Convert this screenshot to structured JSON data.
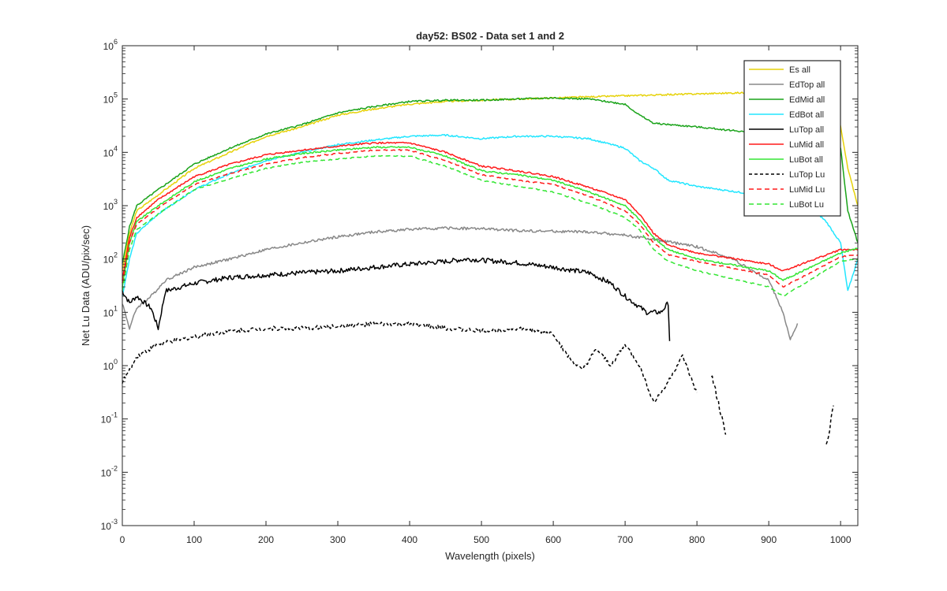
{
  "chart_data": {
    "type": "line",
    "title": "day52: BS02 - Data set 1 and 2",
    "xlabel": "Wavelength (pixels)",
    "ylabel": "Net Lu Data (ADU/pix/sec)",
    "xlim": [
      0,
      1024
    ],
    "ylim": [
      0.001,
      1000000
    ],
    "y_scale": "log",
    "x_ticks": [
      0,
      100,
      200,
      300,
      400,
      500,
      600,
      700,
      800,
      900,
      1000
    ],
    "y_ticks": [
      {
        "value": 0.001,
        "base": "10",
        "exp": "-3"
      },
      {
        "value": 0.01,
        "base": "10",
        "exp": "-2"
      },
      {
        "value": 0.1,
        "base": "10",
        "exp": "-1"
      },
      {
        "value": 1,
        "base": "10",
        "exp": "0"
      },
      {
        "value": 10,
        "base": "10",
        "exp": "1"
      },
      {
        "value": 100,
        "base": "10",
        "exp": "2"
      },
      {
        "value": 1000,
        "base": "10",
        "exp": "3"
      },
      {
        "value": 10000,
        "base": "10",
        "exp": "4"
      },
      {
        "value": 100000,
        "base": "10",
        "exp": "5"
      },
      {
        "value": 1000000,
        "base": "10",
        "exp": "6"
      }
    ],
    "grid": false,
    "legend_position": "top-right",
    "series": [
      {
        "name": "Es  all",
        "color": "#e6d20a",
        "dash": "solid",
        "x": [
          0,
          10,
          20,
          50,
          100,
          150,
          200,
          250,
          300,
          350,
          400,
          450,
          500,
          550,
          600,
          650,
          700,
          750,
          800,
          900,
          990,
          1000,
          1010,
          1024
        ],
        "y": [
          60,
          300,
          800,
          1600,
          5000,
          10000,
          20000,
          30000,
          50000,
          65000,
          80000,
          90000,
          95000,
          100000,
          105000,
          110000,
          115000,
          120000,
          125000,
          135000,
          135000,
          30000,
          5000,
          1000
        ]
      },
      {
        "name": "EdTop  all",
        "color": "#888888",
        "dash": "solid",
        "x": [
          0,
          10,
          20,
          40,
          60,
          100,
          150,
          200,
          250,
          300,
          350,
          400,
          450,
          500,
          550,
          600,
          650,
          700,
          750,
          800,
          850,
          900,
          920,
          930,
          940
        ],
        "y": [
          15,
          5,
          12,
          20,
          40,
          70,
          100,
          150,
          200,
          260,
          320,
          360,
          380,
          370,
          340,
          330,
          320,
          280,
          220,
          170,
          100,
          40,
          10,
          3,
          6
        ]
      },
      {
        "name": "EdMid  all",
        "color": "#1aa31a",
        "dash": "solid",
        "x": [
          0,
          10,
          20,
          50,
          100,
          150,
          200,
          250,
          300,
          350,
          400,
          450,
          500,
          550,
          600,
          650,
          700,
          720,
          740,
          800,
          900,
          1000,
          1010,
          1024
        ],
        "y": [
          80,
          400,
          1000,
          2000,
          6000,
          12000,
          22000,
          33000,
          55000,
          72000,
          90000,
          95000,
          95000,
          100000,
          105000,
          100000,
          80000,
          50000,
          35000,
          30000,
          22000,
          12000,
          800,
          200
        ]
      },
      {
        "name": "EdBot  all",
        "color": "#22e6ff",
        "dash": "solid",
        "x": [
          0,
          10,
          20,
          50,
          100,
          150,
          200,
          250,
          300,
          350,
          400,
          450,
          500,
          550,
          600,
          650,
          700,
          720,
          740,
          760,
          800,
          900,
          960,
          980,
          1000,
          1010,
          1024
        ],
        "y": [
          20,
          100,
          300,
          700,
          2000,
          4000,
          7000,
          10000,
          14000,
          17000,
          20000,
          21000,
          18000,
          20000,
          20000,
          18000,
          12000,
          7000,
          5000,
          3000,
          2300,
          1500,
          900,
          500,
          200,
          25,
          100
        ]
      },
      {
        "name": "LuTop  all",
        "color": "#000000",
        "dash": "solid",
        "x": [
          0,
          10,
          20,
          40,
          50,
          60,
          100,
          150,
          200,
          250,
          300,
          350,
          400,
          450,
          480,
          500,
          550,
          600,
          650,
          680,
          700,
          730,
          750,
          760,
          762
        ],
        "y": [
          25,
          15,
          20,
          12,
          5,
          25,
          35,
          45,
          50,
          55,
          60,
          70,
          80,
          90,
          100,
          95,
          85,
          70,
          55,
          35,
          20,
          10,
          10,
          15,
          3
        ]
      },
      {
        "name": "LuMid  all",
        "color": "#ff1a1a",
        "dash": "solid",
        "x": [
          0,
          10,
          20,
          50,
          100,
          150,
          200,
          250,
          300,
          350,
          400,
          450,
          500,
          550,
          600,
          650,
          700,
          720,
          740,
          760,
          800,
          900,
          920,
          1000,
          1024
        ],
        "y": [
          40,
          250,
          600,
          1300,
          3500,
          6000,
          9000,
          11000,
          13000,
          15000,
          15000,
          10000,
          5500,
          4500,
          3500,
          2200,
          1300,
          700,
          300,
          180,
          130,
          80,
          60,
          150,
          150
        ]
      },
      {
        "name": "LuBot  all",
        "color": "#33e633",
        "dash": "solid",
        "x": [
          0,
          10,
          20,
          50,
          100,
          150,
          200,
          250,
          300,
          350,
          400,
          450,
          500,
          550,
          600,
          650,
          700,
          720,
          740,
          760,
          800,
          900,
          920,
          1000,
          1024
        ],
        "y": [
          30,
          200,
          500,
          1000,
          2800,
          5000,
          7500,
          9500,
          11000,
          12500,
          12500,
          8500,
          4500,
          3800,
          3000,
          1800,
          1000,
          550,
          250,
          150,
          100,
          60,
          40,
          130,
          160
        ]
      },
      {
        "name": "LuTop  Lu",
        "color": "#000000",
        "dash": "4,3",
        "x": [
          0,
          10,
          20,
          50,
          100,
          150,
          200,
          250,
          300,
          350,
          400,
          450,
          500,
          550,
          600,
          620,
          640,
          660,
          680,
          700,
          720,
          740,
          760,
          780,
          800
        ],
        "y": [
          0.5,
          0.8,
          1.5,
          2.5,
          3.5,
          4.5,
          5,
          5,
          5.5,
          6,
          6,
          5,
          4.5,
          5,
          4,
          1.5,
          0.8,
          2,
          1,
          2.5,
          1,
          0.2,
          0.5,
          1.5,
          0.3
        ],
        "extra_segments": [
          {
            "x": [
              820,
              830,
              840
            ],
            "y": [
              0.7,
              0.2,
              0.05
            ]
          },
          {
            "x": [
              980,
              985,
              990
            ],
            "y": [
              0.03,
              0.06,
              0.2
            ]
          }
        ]
      },
      {
        "name": "LuMid  Lu",
        "color": "#ff1a1a",
        "dash": "6,4",
        "x": [
          0,
          10,
          20,
          50,
          100,
          150,
          200,
          250,
          300,
          350,
          400,
          450,
          500,
          550,
          600,
          650,
          700,
          720,
          740,
          760,
          800,
          900,
          920,
          1000,
          1024
        ],
        "y": [
          35,
          200,
          450,
          900,
          2500,
          4000,
          6000,
          8000,
          9500,
          11000,
          11000,
          7000,
          3800,
          3000,
          2500,
          1500,
          800,
          450,
          200,
          120,
          90,
          50,
          30,
          110,
          120
        ]
      },
      {
        "name": "LuBot  Lu",
        "color": "#33e633",
        "dash": "6,4",
        "x": [
          0,
          10,
          20,
          50,
          100,
          150,
          200,
          250,
          300,
          350,
          400,
          450,
          500,
          550,
          600,
          650,
          700,
          720,
          740,
          760,
          800,
          900,
          920,
          1000,
          1024
        ],
        "y": [
          25,
          150,
          350,
          700,
          2000,
          3200,
          5000,
          6500,
          7500,
          8500,
          8500,
          5500,
          3000,
          2300,
          1800,
          1100,
          600,
          350,
          150,
          90,
          60,
          30,
          20,
          90,
          100
        ]
      }
    ]
  }
}
